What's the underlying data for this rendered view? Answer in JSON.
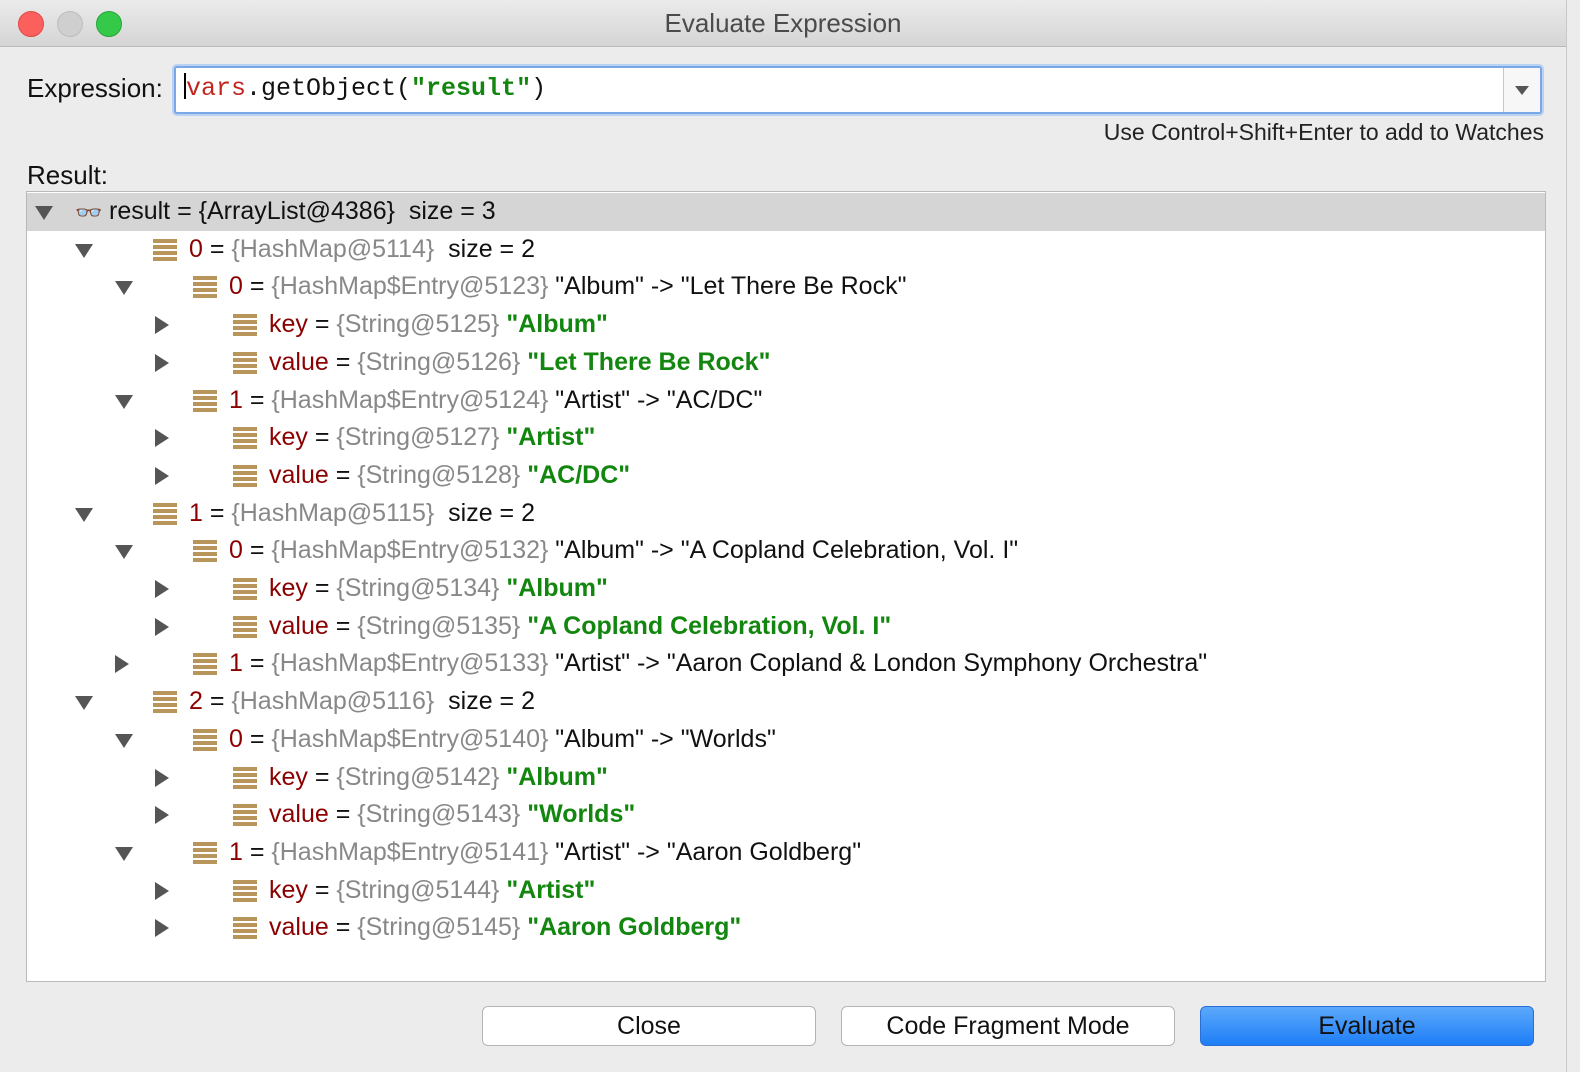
{
  "window": {
    "title": "Evaluate Expression"
  },
  "expression": {
    "label": "Expression:",
    "code_kw": "vars",
    "code_mid": ".getObject(",
    "code_str": "\"result\"",
    "code_end": ")",
    "hint": "Use Control+Shift+Enter to add to Watches"
  },
  "result": {
    "label": "Result:",
    "rows": [
      {
        "depth": 0,
        "toggle": "open",
        "icon": "watch",
        "name": "result",
        "eq": " = ",
        "ref": "{ArrayList@4386}",
        "val": "  size = 3",
        "green": false,
        "sel": true
      },
      {
        "depth": 1,
        "toggle": "open",
        "icon": "field",
        "name": "0",
        "eq": " = ",
        "ref": "{HashMap@5114}",
        "val": "  size = 2",
        "green": false
      },
      {
        "depth": 2,
        "toggle": "open",
        "icon": "field",
        "name": "0",
        "eq": " = ",
        "ref": "{HashMap$Entry@5123}",
        "val": " \"Album\" -> \"Let There Be Rock\"",
        "green": false
      },
      {
        "depth": 3,
        "toggle": "closed",
        "icon": "field",
        "name": "key",
        "eq": " = ",
        "ref": "{String@5125}",
        "val": " \"Album\"",
        "green": true
      },
      {
        "depth": 3,
        "toggle": "closed",
        "icon": "field",
        "name": "value",
        "eq": " = ",
        "ref": "{String@5126}",
        "val": " \"Let There Be Rock\"",
        "green": true
      },
      {
        "depth": 2,
        "toggle": "open",
        "icon": "field",
        "name": "1",
        "eq": " = ",
        "ref": "{HashMap$Entry@5124}",
        "val": " \"Artist\" -> \"AC/DC\"",
        "green": false
      },
      {
        "depth": 3,
        "toggle": "closed",
        "icon": "field",
        "name": "key",
        "eq": " = ",
        "ref": "{String@5127}",
        "val": " \"Artist\"",
        "green": true
      },
      {
        "depth": 3,
        "toggle": "closed",
        "icon": "field",
        "name": "value",
        "eq": " = ",
        "ref": "{String@5128}",
        "val": " \"AC/DC\"",
        "green": true
      },
      {
        "depth": 1,
        "toggle": "open",
        "icon": "field",
        "name": "1",
        "eq": " = ",
        "ref": "{HashMap@5115}",
        "val": "  size = 2",
        "green": false
      },
      {
        "depth": 2,
        "toggle": "open",
        "icon": "field",
        "name": "0",
        "eq": " = ",
        "ref": "{HashMap$Entry@5132}",
        "val": " \"Album\" -> \"A Copland Celebration, Vol. I\"",
        "green": false
      },
      {
        "depth": 3,
        "toggle": "closed",
        "icon": "field",
        "name": "key",
        "eq": " = ",
        "ref": "{String@5134}",
        "val": " \"Album\"",
        "green": true
      },
      {
        "depth": 3,
        "toggle": "closed",
        "icon": "field",
        "name": "value",
        "eq": " = ",
        "ref": "{String@5135}",
        "val": " \"A Copland Celebration, Vol. I\"",
        "green": true
      },
      {
        "depth": 2,
        "toggle": "closed",
        "icon": "field",
        "name": "1",
        "eq": " = ",
        "ref": "{HashMap$Entry@5133}",
        "val": " \"Artist\" -> \"Aaron Copland & London Symphony Orchestra\"",
        "green": false
      },
      {
        "depth": 1,
        "toggle": "open",
        "icon": "field",
        "name": "2",
        "eq": " = ",
        "ref": "{HashMap@5116}",
        "val": "  size = 2",
        "green": false
      },
      {
        "depth": 2,
        "toggle": "open",
        "icon": "field",
        "name": "0",
        "eq": " = ",
        "ref": "{HashMap$Entry@5140}",
        "val": " \"Album\" -> \"Worlds\"",
        "green": false
      },
      {
        "depth": 3,
        "toggle": "closed",
        "icon": "field",
        "name": "key",
        "eq": " = ",
        "ref": "{String@5142}",
        "val": " \"Album\"",
        "green": true
      },
      {
        "depth": 3,
        "toggle": "closed",
        "icon": "field",
        "name": "value",
        "eq": " = ",
        "ref": "{String@5143}",
        "val": " \"Worlds\"",
        "green": true
      },
      {
        "depth": 2,
        "toggle": "open",
        "icon": "field",
        "name": "1",
        "eq": " = ",
        "ref": "{HashMap$Entry@5141}",
        "val": " \"Artist\" -> \"Aaron Goldberg\"",
        "green": false
      },
      {
        "depth": 3,
        "toggle": "closed",
        "icon": "field",
        "name": "key",
        "eq": " = ",
        "ref": "{String@5144}",
        "val": " \"Artist\"",
        "green": true
      },
      {
        "depth": 3,
        "toggle": "closed",
        "icon": "field",
        "name": "value",
        "eq": " = ",
        "ref": "{String@5145}",
        "val": " \"Aaron Goldberg\"",
        "green": true
      }
    ]
  },
  "buttons": {
    "close": "Close",
    "code_fragment": "Code Fragment Mode",
    "evaluate": "Evaluate"
  },
  "colors": {
    "primary_button": "#1e7ef7",
    "field_name": "#8b0000",
    "string_value": "#13860f",
    "ref": "#888888"
  }
}
